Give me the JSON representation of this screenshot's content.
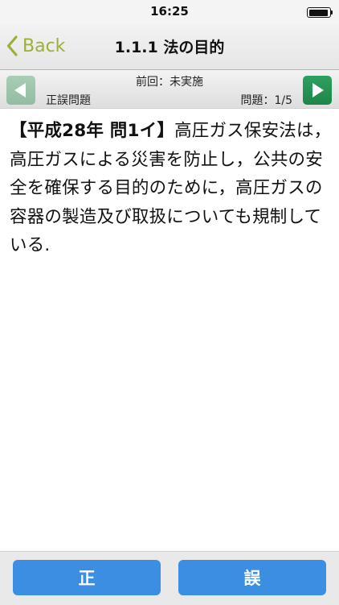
{
  "status": {
    "time": "16:25",
    "battery_level": 0.95
  },
  "nav": {
    "back_label": "Back",
    "title": "1.1.1 法の目的"
  },
  "toolbar": {
    "previous_result": "前回：未実施",
    "mode_label": "正誤問題",
    "progress": "問題：1/5",
    "prev_icon": "triangle-left-icon",
    "next_icon": "triangle-right-icon"
  },
  "question": {
    "tag": "【平成28年 問1イ】",
    "text": "高圧ガス保安法は，高圧ガスによる災害を防止し，公共の安全を確保する目的のために，高圧ガスの容器の製造及び取扱についても規制している."
  },
  "answers": {
    "true_label": "正",
    "false_label": "誤"
  },
  "colors": {
    "accent_back": "#9db036",
    "next_button": "#23894f",
    "prev_button_disabled": "#9fc6ad",
    "answer_button": "#3c8ee3"
  }
}
